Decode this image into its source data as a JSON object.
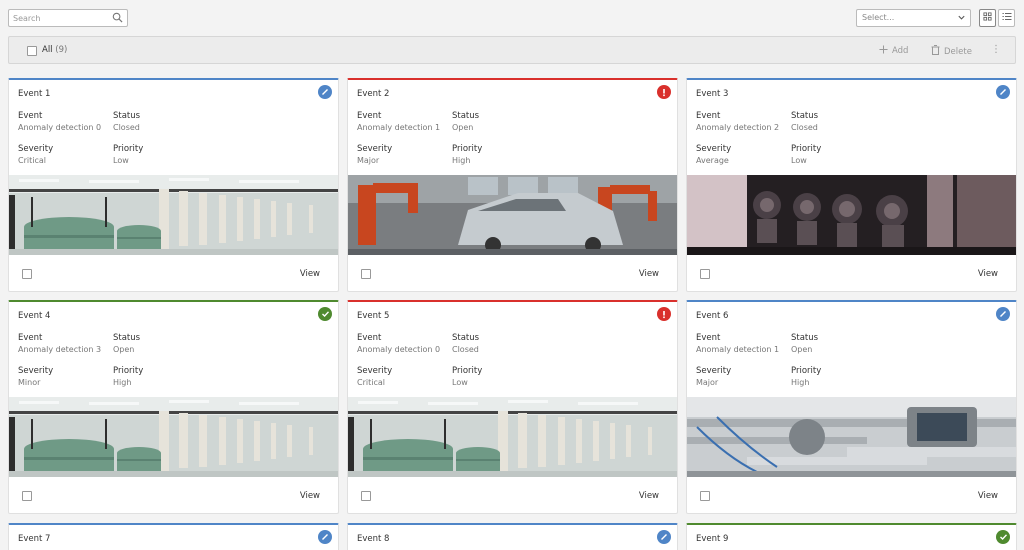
{
  "search": {
    "placeholder": "Search"
  },
  "sort_select": {
    "placeholder": "Select..."
  },
  "toolbar": {
    "all_label": "All",
    "all_count": "(9)",
    "add_label": "Add",
    "delete_label": "Delete"
  },
  "field_labels": {
    "event": "Event",
    "status": "Status",
    "severity": "Severity",
    "priority": "Priority"
  },
  "view_label": "View",
  "colors": {
    "blue": "#4f85c7",
    "red": "#d9302c",
    "green": "#4f8a2f"
  },
  "cards": [
    {
      "title": "Event 1",
      "event": "Anomaly detection 0",
      "status": "Closed",
      "severity": "Critical",
      "priority": "Low",
      "badge": "edit-icon",
      "accent": "#4f85c7",
      "image": "textile-factory"
    },
    {
      "title": "Event 2",
      "event": "Anomaly detection 1",
      "status": "Open",
      "severity": "Major",
      "priority": "High",
      "badge": "error-icon",
      "accent": "#d9302c",
      "image": "car-assembly"
    },
    {
      "title": "Event 3",
      "event": "Anomaly detection 2",
      "status": "Closed",
      "severity": "Average",
      "priority": "Low",
      "badge": "edit-icon",
      "accent": "#4f85c7",
      "image": "valves"
    },
    {
      "title": "Event 4",
      "event": "Anomaly detection 3",
      "status": "Open",
      "severity": "Minor",
      "priority": "High",
      "badge": "check-icon",
      "accent": "#4f8a2f",
      "image": "textile-factory"
    },
    {
      "title": "Event 5",
      "event": "Anomaly detection 0",
      "status": "Closed",
      "severity": "Critical",
      "priority": "Low",
      "badge": "error-icon",
      "accent": "#d9302c",
      "image": "textile-factory"
    },
    {
      "title": "Event 6",
      "event": "Anomaly detection 1",
      "status": "Open",
      "severity": "Major",
      "priority": "High",
      "badge": "edit-icon",
      "accent": "#4f85c7",
      "image": "pipes"
    },
    {
      "title": "Event 7",
      "badge": "edit-icon",
      "accent": "#4f85c7"
    },
    {
      "title": "Event 8",
      "badge": "edit-icon",
      "accent": "#4f85c7"
    },
    {
      "title": "Event 9",
      "badge": "check-icon",
      "accent": "#4f8a2f"
    }
  ]
}
